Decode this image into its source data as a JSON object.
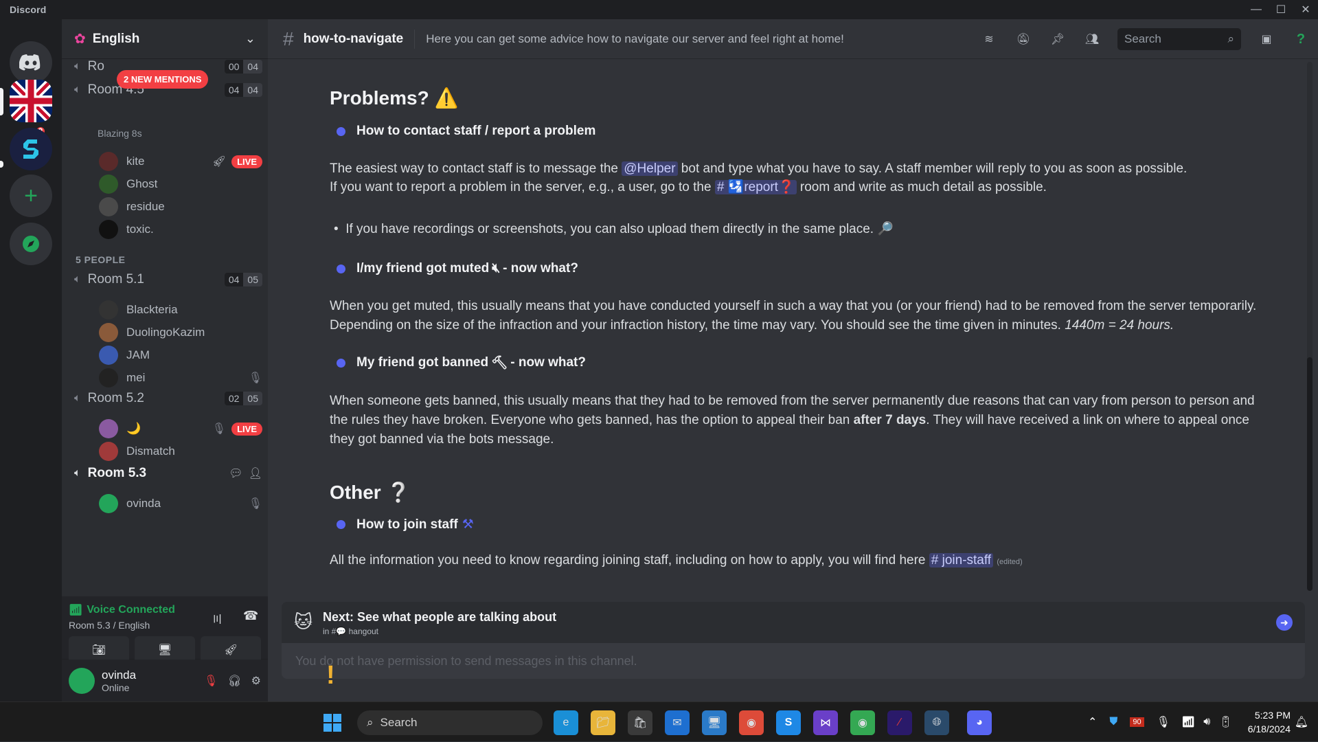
{
  "window": {
    "app_name": "Discord"
  },
  "guild": {
    "name": "English"
  },
  "sidebar": {
    "mentions_pill": "2 NEW MENTIONS",
    "rooms": [
      {
        "name": "Ro",
        "count_a": "00",
        "count_b": "04"
      },
      {
        "name": "Room 4.5",
        "sub": "Blazing 8s",
        "count_a": "04",
        "count_b": "04",
        "members": [
          {
            "name": "kite",
            "live": "LIVE"
          },
          {
            "name": "Ghost"
          },
          {
            "name": "residue"
          },
          {
            "name": "toxic."
          }
        ]
      },
      {
        "name": "Room 5.1",
        "count_a": "04",
        "count_b": "05",
        "members": [
          {
            "name": "Blackteria"
          },
          {
            "name": "DuolingoKazim"
          },
          {
            "name": "JAM"
          },
          {
            "name": "mei"
          }
        ]
      },
      {
        "name": "Room 5.2",
        "count_a": "02",
        "count_b": "05",
        "members": [
          {
            "name": "🌙",
            "live": "LIVE"
          },
          {
            "name": "Dismatch"
          }
        ]
      },
      {
        "name": "Room 5.3",
        "members": [
          {
            "name": "ovinda"
          }
        ]
      }
    ],
    "section_label": "5 PEOPLE"
  },
  "voice": {
    "status": "Voice Connected",
    "location": "Room 5.3 / English"
  },
  "user": {
    "name": "ovinda",
    "status": "Online"
  },
  "channel": {
    "name": "how-to-navigate",
    "topic": "Here you can get some advice how to navigate our server and feel right at home!",
    "search_placeholder": "Search"
  },
  "content": {
    "problems_heading": "Problems? ⚠️",
    "contact_heading": "How to contact staff / report a problem",
    "contact_p1a": "The easiest way to contact  staff is to message the ",
    "helper_mention": "@Helper",
    "contact_p1b": " bot and type what you have to say. A staff member will reply to you as soon as possible.",
    "contact_p2a": "If you want to report a problem in the server, e.g., a user, go to the ",
    "report_mention": "# 🛂report❓",
    "contact_p2b": " room and write as much detail as possible.",
    "recordings_bullet": "If you have recordings or screenshots, you can also upload them directly in the same place. 🔎",
    "muted_heading_a": "I/my friend got muted",
    "muted_heading_b": " - now what?",
    "muted_p1": "When you get muted, this usually means that you have conducted yourself in such a way that you (or your friend) had to be removed from the server temporarily.",
    "muted_p2": "Depending on the size of the infraction and your infraction history, the time may vary. You should see the time given in minutes.  ",
    "muted_p2_italic": "1440m = 24 hours.",
    "banned_heading_a": "My friend got banned",
    "banned_heading_b": " - now what?",
    "banned_p1": "When someone gets banned, this usually means that they had to be removed from the server permanently due reasons that can vary from person to person and",
    "banned_p2a": "the rules they have broken. Everyone who gets banned, has the option to appeal their ban ",
    "banned_p2_bold": "after 7 days",
    "banned_p2b": ". They will have received a link on where to appeal once",
    "banned_p3": "they got banned via the bots message.",
    "other_heading": "Other ❔",
    "join_heading": "How to join staff",
    "join_p1": "All the information you need to know regarding joining staff, including on how to apply, you will find here ",
    "join_mention": "# join-staff",
    "edited": "(edited)"
  },
  "next_bar": {
    "title": "Next: See what people are talking about",
    "subtitle": "in #💬 hangout"
  },
  "compose": {
    "placeholder": "You do not have permission to send messages in this channel."
  },
  "taskbar": {
    "search": "Search",
    "clock_time": "5:23 PM",
    "clock_date": "6/18/2024",
    "battery_badge": "90"
  },
  "colors": {
    "accent": "#5865f2",
    "danger": "#f23f43",
    "online": "#23a55a"
  }
}
